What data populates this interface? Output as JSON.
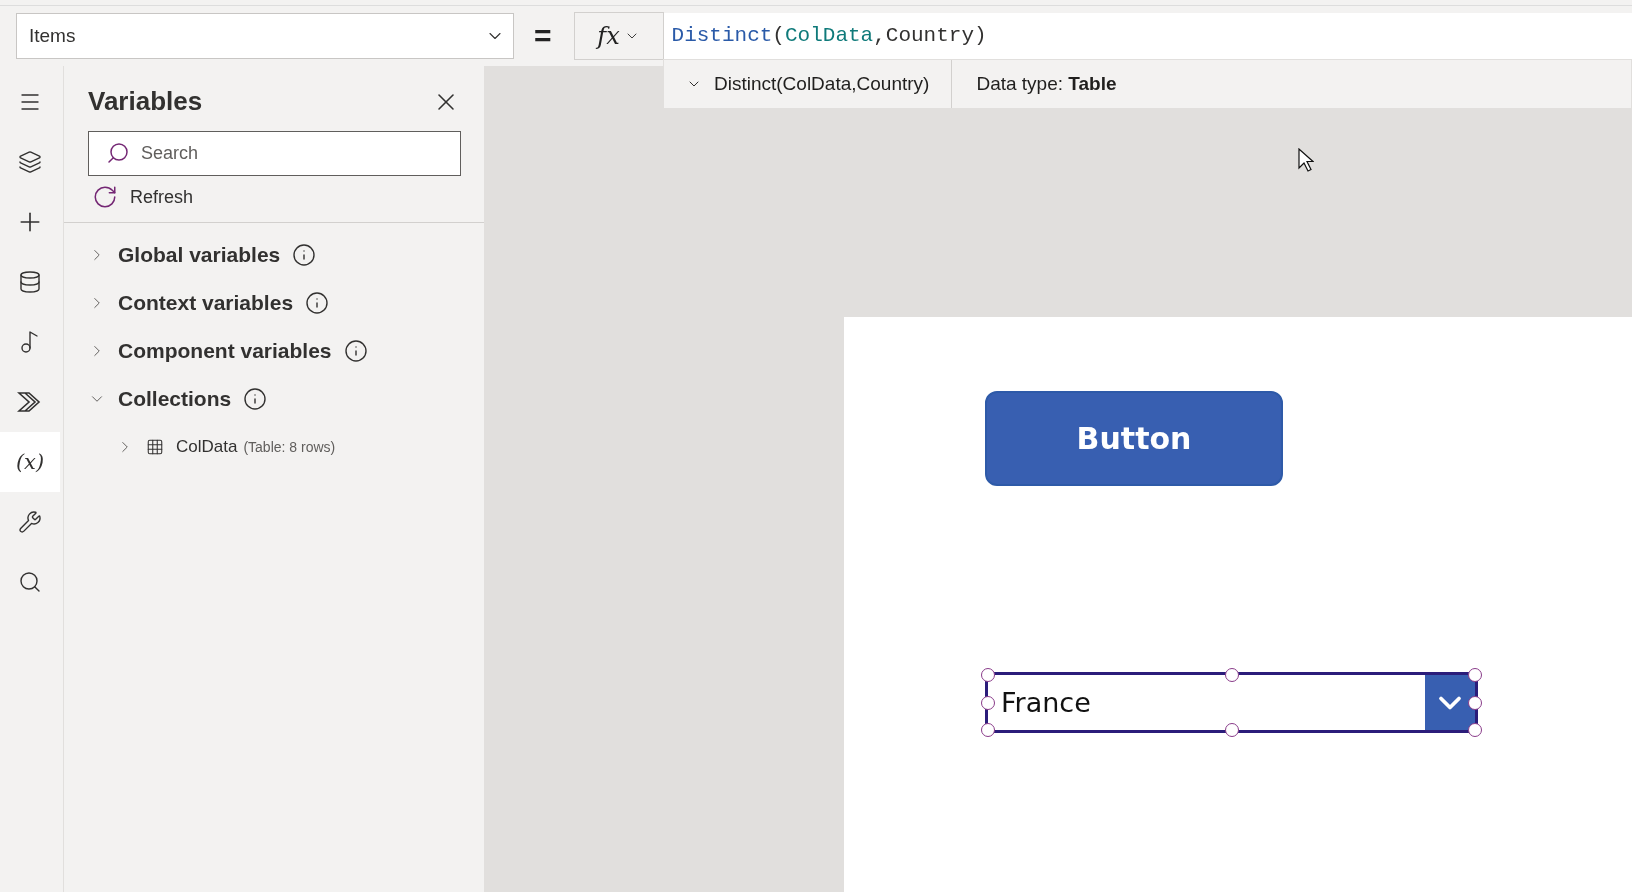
{
  "property_selector": {
    "value": "Items"
  },
  "equals": "=",
  "formula_bar": {
    "fx": "fx",
    "tokens": [
      {
        "text": "Distinct",
        "kind": "function"
      },
      {
        "text": "(",
        "kind": "plain"
      },
      {
        "text": "ColData",
        "kind": "name"
      },
      {
        "text": ",Country)",
        "kind": "plain"
      }
    ]
  },
  "formula_tooltip": {
    "expression": "Distinct(ColData,Country)",
    "data_type": "Data type: **Table**"
  },
  "rail": [
    {
      "kind": "menu",
      "selected": false
    },
    {
      "kind": "layers",
      "selected": false
    },
    {
      "kind": "insert",
      "selected": false
    },
    {
      "kind": "data",
      "selected": false
    },
    {
      "kind": "media",
      "selected": false
    },
    {
      "kind": "automate",
      "selected": false
    },
    {
      "kind": "variables",
      "glyph": "(x)",
      "selected": true
    },
    {
      "kind": "tools",
      "selected": false
    },
    {
      "kind": "search",
      "selected": false
    }
  ],
  "panel": {
    "title": "Variables",
    "search": {
      "placeholder": "Search"
    },
    "refresh": "Refresh",
    "sections": [
      {
        "label": "Global variables",
        "expanded": false
      },
      {
        "label": "Context variables",
        "expanded": false
      },
      {
        "label": "Component variables",
        "expanded": false
      },
      {
        "label": "Collections",
        "expanded": true,
        "children": [
          {
            "label": "ColData",
            "meta": "(Table: 8 rows)",
            "expanded": false
          }
        ]
      }
    ]
  },
  "canvas": {
    "button": {
      "label": "Button"
    },
    "dropdown": {
      "value": "France",
      "selected": true
    }
  }
}
